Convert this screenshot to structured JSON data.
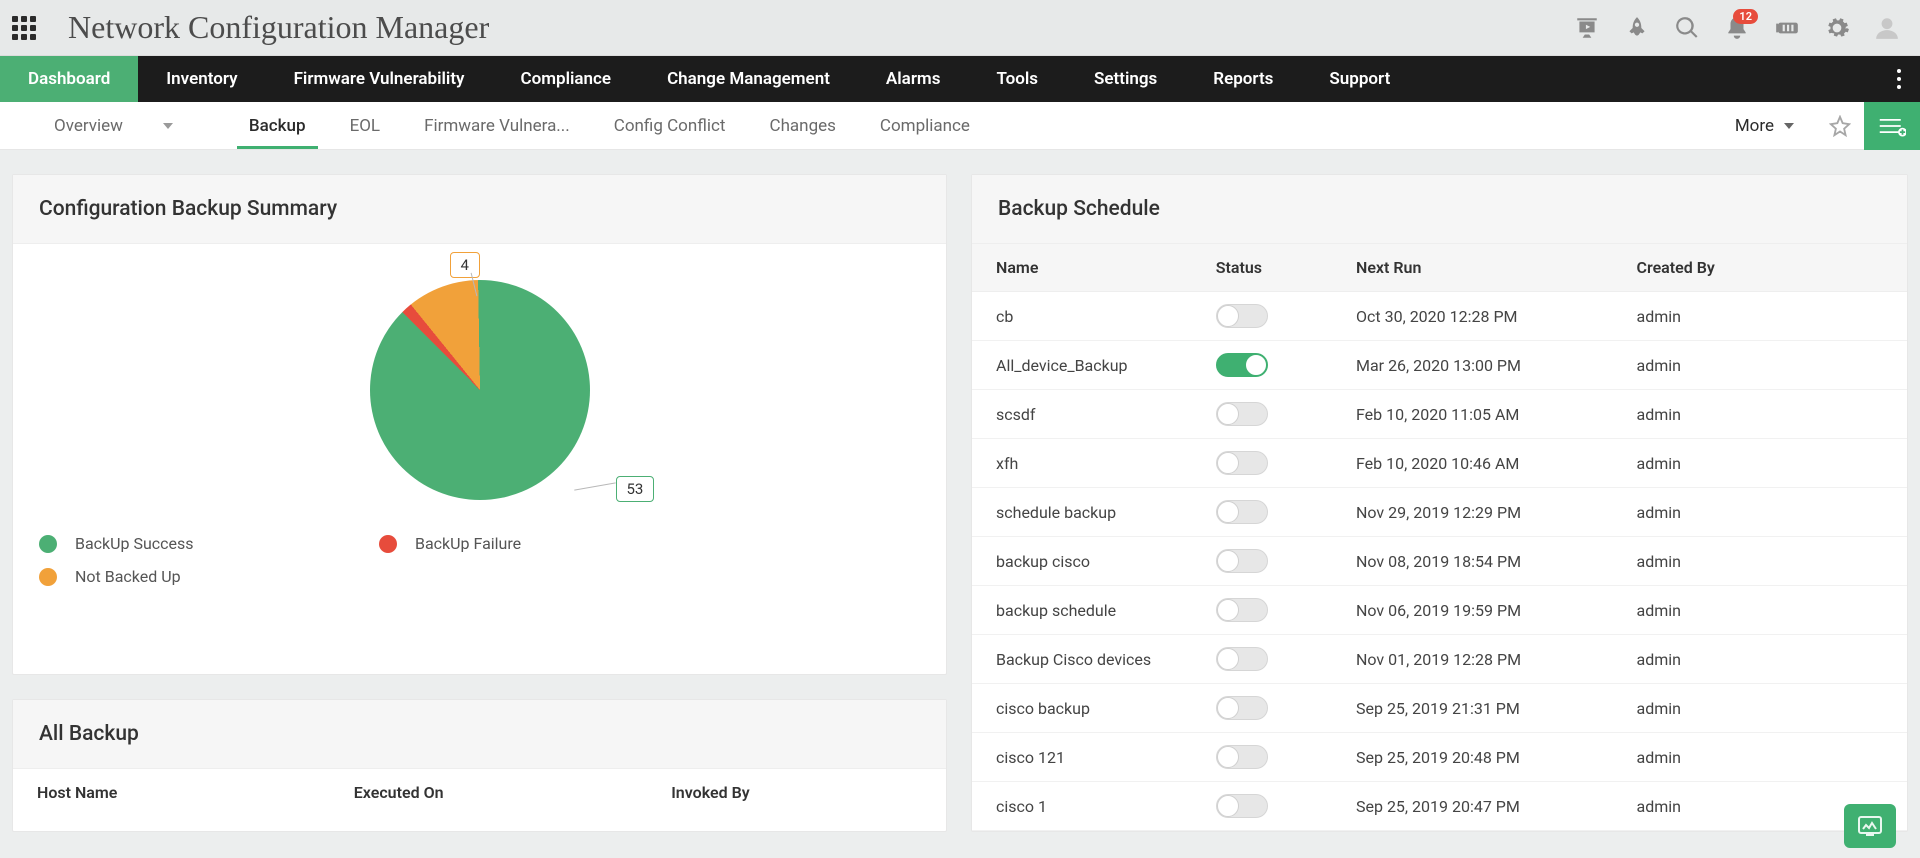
{
  "header": {
    "title": "Network Configuration Manager",
    "notification_count": "12"
  },
  "main_nav": [
    {
      "label": "Dashboard",
      "active": true
    },
    {
      "label": "Inventory",
      "active": false
    },
    {
      "label": "Firmware Vulnerability",
      "active": false
    },
    {
      "label": "Compliance",
      "active": false
    },
    {
      "label": "Change Management",
      "active": false
    },
    {
      "label": "Alarms",
      "active": false
    },
    {
      "label": "Tools",
      "active": false
    },
    {
      "label": "Settings",
      "active": false
    },
    {
      "label": "Reports",
      "active": false
    },
    {
      "label": "Support",
      "active": false
    }
  ],
  "sub_nav": {
    "items": [
      {
        "label": "Overview",
        "active": false,
        "dropdown": true
      },
      {
        "label": "Backup",
        "active": true
      },
      {
        "label": "EOL",
        "active": false
      },
      {
        "label": "Firmware Vulnera...",
        "active": false
      },
      {
        "label": "Config Conflict",
        "active": false
      },
      {
        "label": "Changes",
        "active": false
      },
      {
        "label": "Compliance",
        "active": false
      }
    ],
    "more_label": "More"
  },
  "summary_panel": {
    "title": "Configuration Backup Summary",
    "labels": {
      "success": "53",
      "not_backed": "4"
    },
    "legend": [
      {
        "label": "BackUp Success",
        "color": "green"
      },
      {
        "label": "BackUp Failure",
        "color": "red"
      },
      {
        "label": "Not Backed Up",
        "color": "orange"
      }
    ]
  },
  "chart_data": {
    "type": "pie",
    "title": "Configuration Backup Summary",
    "series": [
      {
        "name": "BackUp Success",
        "value": 53,
        "color": "#4caf74"
      },
      {
        "name": "BackUp Failure",
        "value": 1,
        "color": "#e74c3c"
      },
      {
        "name": "Not Backed Up",
        "value": 4,
        "color": "#f1a13a"
      }
    ]
  },
  "schedule_panel": {
    "title": "Backup Schedule",
    "columns": [
      "Name",
      "Status",
      "Next Run",
      "Created By"
    ],
    "rows": [
      {
        "name": "cb",
        "on": false,
        "next": "Oct 30, 2020 12:28 PM",
        "by": "admin"
      },
      {
        "name": "All_device_Backup",
        "on": true,
        "next": "Mar 26, 2020 13:00 PM",
        "by": "admin"
      },
      {
        "name": "scsdf",
        "on": false,
        "next": "Feb 10, 2020 11:05 AM",
        "by": "admin"
      },
      {
        "name": "xfh",
        "on": false,
        "next": "Feb 10, 2020 10:46 AM",
        "by": "admin"
      },
      {
        "name": "schedule backup",
        "on": false,
        "next": "Nov 29, 2019 12:29 PM",
        "by": "admin"
      },
      {
        "name": "backup cisco",
        "on": false,
        "next": "Nov 08, 2019 18:54 PM",
        "by": "admin"
      },
      {
        "name": "backup schedule",
        "on": false,
        "next": "Nov 06, 2019 19:59 PM",
        "by": "admin"
      },
      {
        "name": "Backup Cisco devices",
        "on": false,
        "next": "Nov 01, 2019 12:28 PM",
        "by": "admin"
      },
      {
        "name": "cisco backup",
        "on": false,
        "next": "Sep 25, 2019 21:31 PM",
        "by": "admin"
      },
      {
        "name": "cisco 121",
        "on": false,
        "next": "Sep 25, 2019 20:48 PM",
        "by": "admin"
      },
      {
        "name": "cisco 1",
        "on": false,
        "next": "Sep 25, 2019 20:47 PM",
        "by": "admin"
      }
    ]
  },
  "all_backup_panel": {
    "title": "All Backup",
    "columns": [
      "Host Name",
      "Executed On",
      "Invoked By"
    ]
  }
}
